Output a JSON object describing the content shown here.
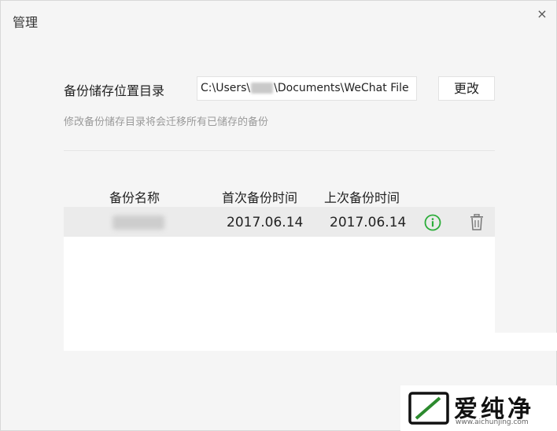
{
  "window": {
    "title": "管理",
    "close_symbol": "×"
  },
  "backup_dir": {
    "label": "备份储存位置目录",
    "path_prefix": "C:\\Users\\",
    "path_suffix": "\\Documents\\WeChat File",
    "change_label": "更改",
    "hint": "修改备份储存目录将会迁移所有已储存的备份"
  },
  "table": {
    "headers": [
      "备份名称",
      "首次备份时间",
      "上次备份时间"
    ],
    "rows": [
      {
        "first_backup": "2017.06.14",
        "last_backup": "2017.06.14"
      }
    ]
  },
  "icons": {
    "info": "info-circle-icon",
    "delete": "trash-icon"
  },
  "colors": {
    "info_green": "#2bad39",
    "hint_gray": "#9a9a9a"
  },
  "watermark": {
    "text": "爱纯净",
    "url": "www.aichunjing.com"
  }
}
